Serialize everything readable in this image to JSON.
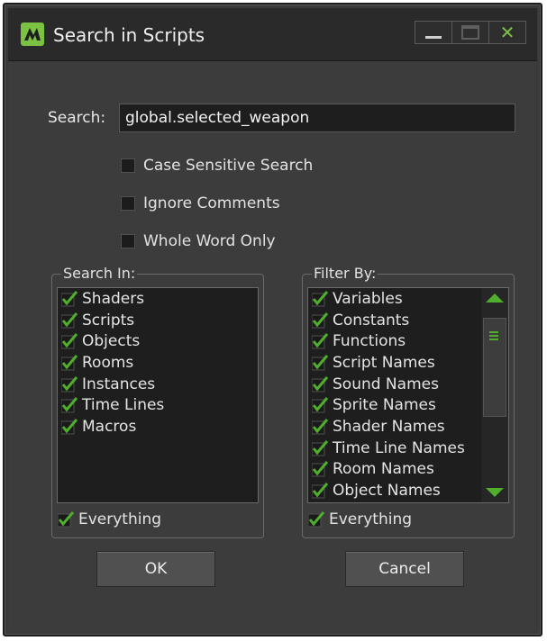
{
  "window": {
    "title": "Search in Scripts",
    "buttons": [
      "minimize",
      "maximize",
      "close"
    ],
    "accent_color": "#4fae2c"
  },
  "search": {
    "label": "Search:",
    "value": "global.selected_weapon"
  },
  "options": [
    {
      "label": "Case Sensitive Search",
      "checked": false
    },
    {
      "label": "Ignore Comments",
      "checked": false
    },
    {
      "label": "Whole Word Only",
      "checked": false
    }
  ],
  "search_in": {
    "legend": "Search In:",
    "items": [
      {
        "label": "Shaders",
        "checked": true
      },
      {
        "label": "Scripts",
        "checked": true
      },
      {
        "label": "Objects",
        "checked": true
      },
      {
        "label": "Rooms",
        "checked": true
      },
      {
        "label": "Instances",
        "checked": true
      },
      {
        "label": "Time Lines",
        "checked": true
      },
      {
        "label": "Macros",
        "checked": true
      }
    ],
    "everything_label": "Everything",
    "everything_checked": true
  },
  "filter_by": {
    "legend": "Filter By:",
    "items": [
      {
        "label": "Variables",
        "checked": true
      },
      {
        "label": "Constants",
        "checked": true
      },
      {
        "label": "Functions",
        "checked": true
      },
      {
        "label": "Script Names",
        "checked": true
      },
      {
        "label": "Sound Names",
        "checked": true
      },
      {
        "label": "Sprite Names",
        "checked": true
      },
      {
        "label": "Shader Names",
        "checked": true
      },
      {
        "label": "Time Line Names",
        "checked": true
      },
      {
        "label": "Room Names",
        "checked": true
      },
      {
        "label": "Object Names",
        "checked": true
      }
    ],
    "everything_label": "Everything",
    "everything_checked": true
  },
  "actions": {
    "ok_label": "OK",
    "cancel_label": "Cancel"
  }
}
